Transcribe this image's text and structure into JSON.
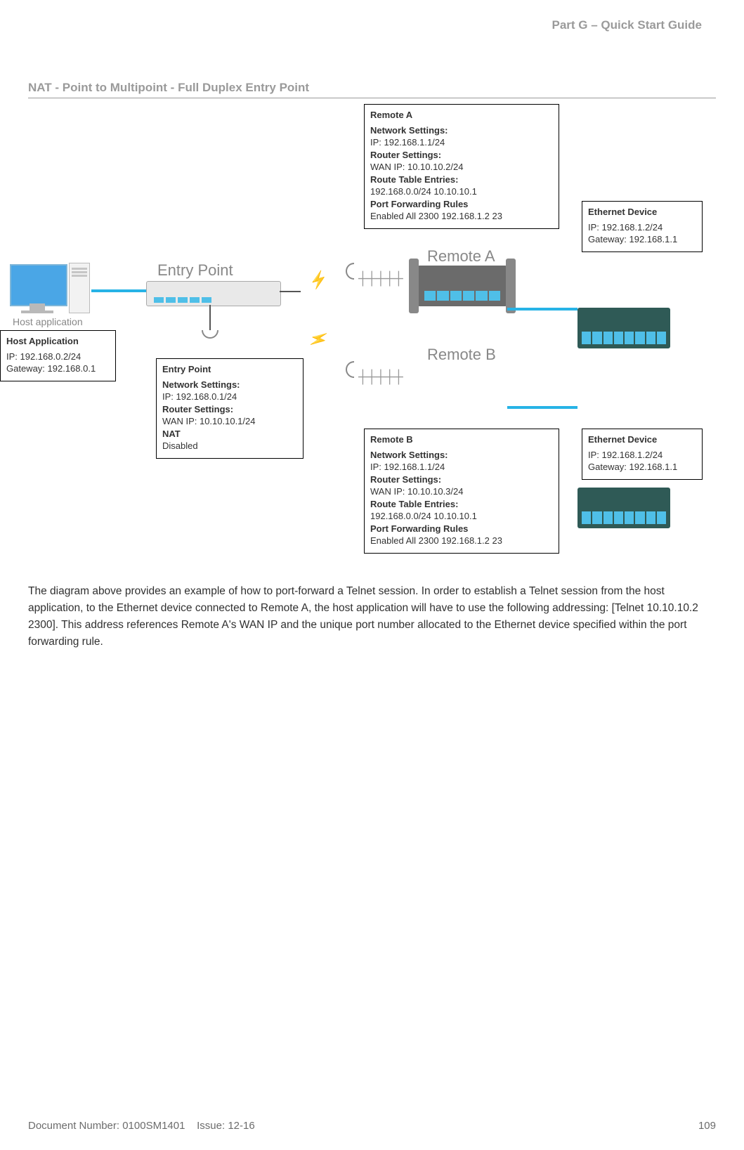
{
  "header": {
    "part": "Part G – Quick Start Guide"
  },
  "section": {
    "title": "NAT - Point to Multipoint - Full Duplex Entry Point"
  },
  "labels": {
    "remote_a": "Remote A",
    "remote_b": "Remote B",
    "entry_point": "Entry Point",
    "host_app": "Host application"
  },
  "host_box": {
    "title": "Host Application",
    "ip": "IP: 192.168.0.2/24",
    "gw": "Gateway: 192.168.0.1"
  },
  "entry_box": {
    "title": "Entry Point",
    "ns_label": "Network Settings:",
    "ns_ip": "IP: 192.168.0.1/24",
    "rs_label": "Router Settings:",
    "rs_wan": "WAN IP: 10.10.10.1/24",
    "nat_label": "NAT",
    "nat_val": "Disabled"
  },
  "remote_a_box": {
    "title": "Remote A",
    "ns_label": "Network Settings:",
    "ns_ip": "IP: 192.168.1.1/24",
    "rs_label": "Router Settings:",
    "rs_wan": "WAN IP: 10.10.10.2/24",
    "rt_label": "Route Table Entries:",
    "rt_val": "192.168.0.0/24 10.10.10.1",
    "pf_label": "Port Forwarding Rules",
    "pf_val": "Enabled All 2300 192.168.1.2 23"
  },
  "remote_b_box": {
    "title": "Remote B",
    "ns_label": "Network Settings:",
    "ns_ip": "IP: 192.168.1.1/24",
    "rs_label": "Router Settings:",
    "rs_wan": "WAN IP: 10.10.10.3/24",
    "rt_label": "Route Table Entries:",
    "rt_val": "192.168.0.0/24 10.10.10.1",
    "pf_label": "Port Forwarding Rules",
    "pf_val": "Enabled All 2300 192.168.1.2 23"
  },
  "eth_a_box": {
    "title": "Ethernet Device",
    "ip": "IP: 192.168.1.2/24",
    "gw": "Gateway: 192.168.1.1"
  },
  "eth_b_box": {
    "title": "Ethernet Device",
    "ip": "IP: 192.168.1.2/24",
    "gw": "Gateway: 192.168.1.1"
  },
  "paragraph": "The diagram above provides an example of how to port-forward a Telnet session. In order to establish a Telnet session from the host application, to the Ethernet device connected to Remote A, the host application will have to use the following addressing: [Telnet 10.10.10.2 2300]. This address references Remote A's WAN IP and the unique port number allocated to the Ethernet device specified within the port forwarding rule.",
  "footer": {
    "doc": "Document Number: 0100SM1401",
    "issue": "Issue: 12-16",
    "page": "109"
  }
}
